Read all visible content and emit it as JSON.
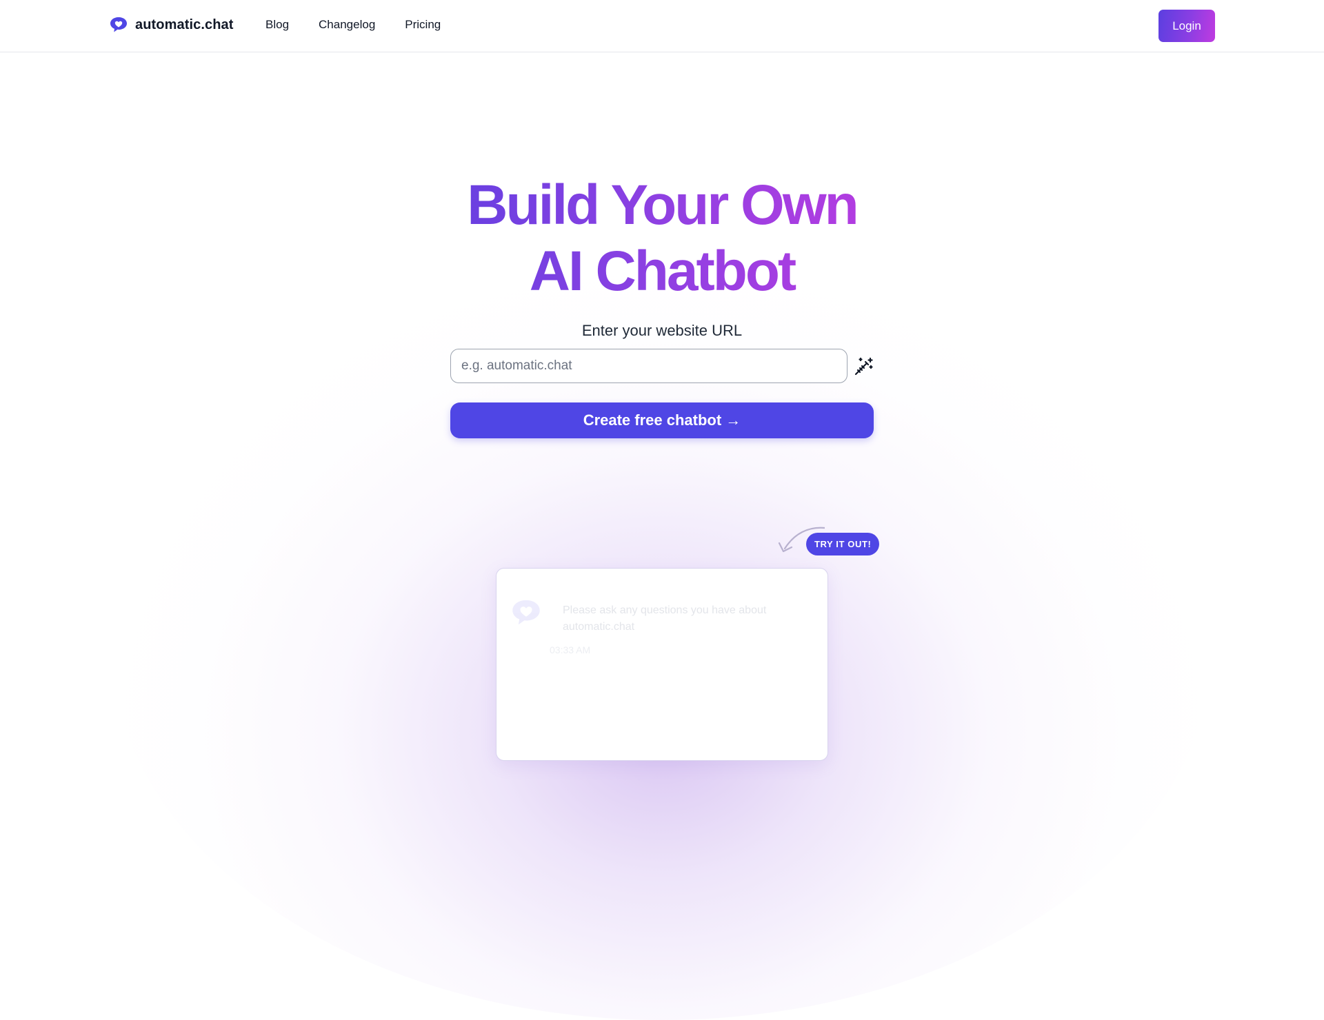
{
  "colors": {
    "accent": "#4f46e5",
    "gradient_start": "#5b3fe0",
    "gradient_end": "#c03be0",
    "text": "#111827"
  },
  "header": {
    "logo_icon": "heart-chat-bubble-icon",
    "brand_name": "automatic.chat",
    "nav": [
      {
        "label": "Blog"
      },
      {
        "label": "Changelog"
      },
      {
        "label": "Pricing"
      }
    ],
    "login_label": "Login"
  },
  "hero": {
    "title_line1": "Build Your Own",
    "title_line2": "AI Chatbot",
    "url_label": "Enter your website URL",
    "url_placeholder": "e.g. automatic.chat",
    "url_value": "",
    "wand_icon": "magic-wand-icon",
    "create_button": "Create free chatbot →"
  },
  "demo": {
    "try_badge": "TRY IT OUT!",
    "arrow_icon": "curved-arrow-icon",
    "chat": {
      "avatar_icon": "heart-chat-bubble-icon",
      "message": "Please ask any questions you have about automatic.chat",
      "time": "03:33 AM"
    }
  }
}
